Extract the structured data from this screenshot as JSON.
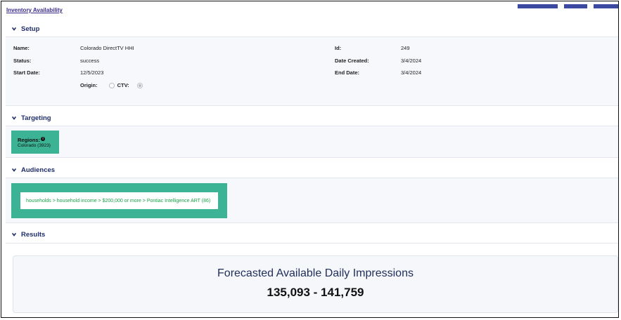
{
  "breadcrumb": "Inventory Availability",
  "setup": {
    "title": "Setup",
    "name_label": "Name:",
    "name_value": "Colorado DirectTV HHI",
    "status_label": "Status:",
    "status_value": "success",
    "start_label": "Start Date:",
    "start_value": "12/5/2023",
    "origin_label": "Origin:",
    "ctv_label": "CTV:",
    "id_label": "Id:",
    "id_value": "249",
    "created_label": "Date Created:",
    "created_value": "3/4/2024",
    "end_label": "End Date:",
    "end_value": "3/4/2024"
  },
  "targeting": {
    "title": "Targeting",
    "regions_label": "Regions:",
    "regions_value": "Colorado (3923)"
  },
  "audiences": {
    "title": "Audiences",
    "item": "households > household income > $200,000 or more > Pontiac Intelligence ART (86)"
  },
  "results": {
    "title": "Results",
    "forecast_title": "Forecasted Available Daily Impressions",
    "forecast_value": "135,093 - 141,759"
  },
  "colors": {
    "accent": "#3b4aa0",
    "teal": "#3bb394",
    "section_title": "#1f2d6b",
    "audience_text": "#1aa24a"
  },
  "icons": {
    "section_toggle": "chevron-down-icon",
    "info": "info-icon"
  }
}
